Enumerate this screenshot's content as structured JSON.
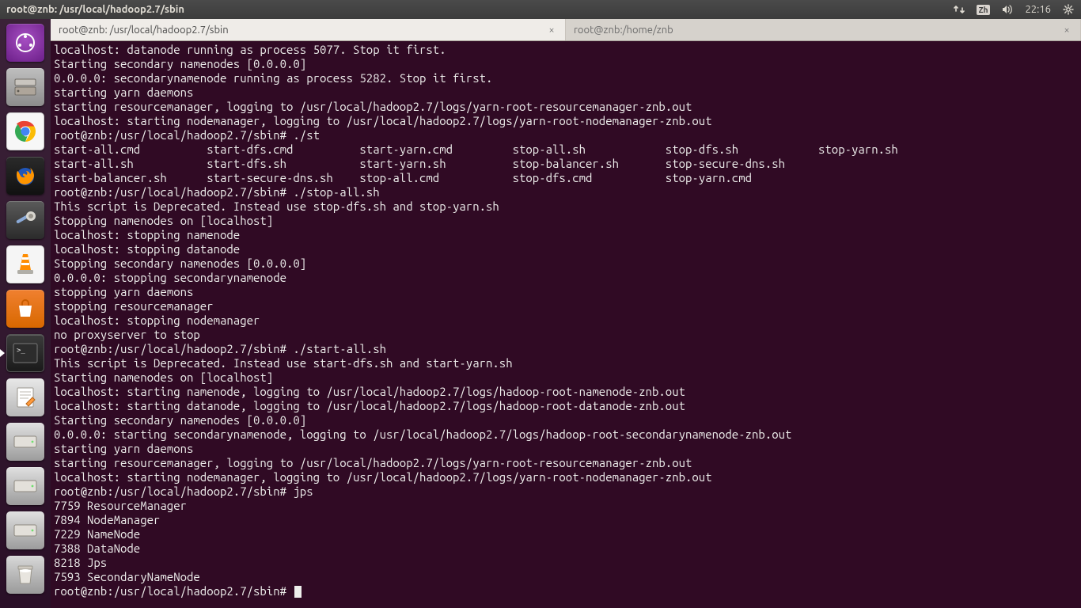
{
  "panel": {
    "title": "root@znb: /usr/local/hadoop2.7/sbin",
    "ime": "Zh",
    "time": "22:16"
  },
  "tabs": {
    "active": {
      "label": "root@znb: /usr/local/hadoop2.7/sbin"
    },
    "inactive": {
      "label": "root@znb:/home/znb"
    }
  },
  "terminal": {
    "lines": [
      "localhost: datanode running as process 5077. Stop it first.",
      "Starting secondary namenodes [0.0.0.0]",
      "0.0.0.0: secondarynamenode running as process 5282. Stop it first.",
      "starting yarn daemons",
      "starting resourcemanager, logging to /usr/local/hadoop2.7/logs/yarn-root-resourcemanager-znb.out",
      "localhost: starting nodemanager, logging to /usr/local/hadoop2.7/logs/yarn-root-nodemanager-znb.out",
      "root@znb:/usr/local/hadoop2.7/sbin# ./st",
      "start-all.cmd          start-dfs.cmd          start-yarn.cmd         stop-all.sh            stop-dfs.sh            stop-yarn.sh",
      "start-all.sh           start-dfs.sh           start-yarn.sh          stop-balancer.sh       stop-secure-dns.sh",
      "start-balancer.sh      start-secure-dns.sh    stop-all.cmd           stop-dfs.cmd           stop-yarn.cmd",
      "root@znb:/usr/local/hadoop2.7/sbin# ./stop-all.sh",
      "This script is Deprecated. Instead use stop-dfs.sh and stop-yarn.sh",
      "Stopping namenodes on [localhost]",
      "localhost: stopping namenode",
      "localhost: stopping datanode",
      "Stopping secondary namenodes [0.0.0.0]",
      "0.0.0.0: stopping secondarynamenode",
      "stopping yarn daemons",
      "stopping resourcemanager",
      "localhost: stopping nodemanager",
      "no proxyserver to stop",
      "root@znb:/usr/local/hadoop2.7/sbin# ./start-all.sh",
      "This script is Deprecated. Instead use start-dfs.sh and start-yarn.sh",
      "Starting namenodes on [localhost]",
      "localhost: starting namenode, logging to /usr/local/hadoop2.7/logs/hadoop-root-namenode-znb.out",
      "localhost: starting datanode, logging to /usr/local/hadoop2.7/logs/hadoop-root-datanode-znb.out",
      "Starting secondary namenodes [0.0.0.0]",
      "0.0.0.0: starting secondarynamenode, logging to /usr/local/hadoop2.7/logs/hadoop-root-secondarynamenode-znb.out",
      "starting yarn daemons",
      "starting resourcemanager, logging to /usr/local/hadoop2.7/logs/yarn-root-resourcemanager-znb.out",
      "localhost: starting nodemanager, logging to /usr/local/hadoop2.7/logs/yarn-root-nodemanager-znb.out",
      "root@znb:/usr/local/hadoop2.7/sbin# jps",
      "7759 ResourceManager",
      "7894 NodeManager",
      "7229 NameNode",
      "7388 DataNode",
      "8218 Jps",
      "7593 SecondaryNameNode"
    ],
    "prompt": "root@znb:/usr/local/hadoop2.7/sbin# "
  }
}
